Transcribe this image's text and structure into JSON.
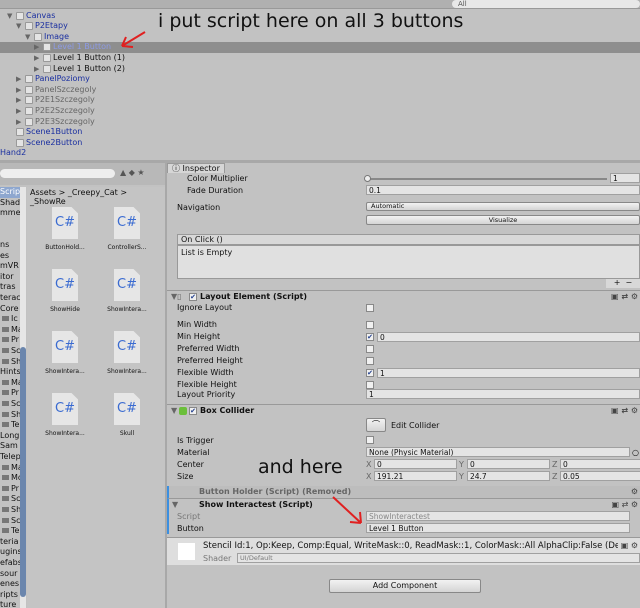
{
  "hierarchy": {
    "search": "All",
    "rows": [
      {
        "label": "Canvas",
        "color": "blue",
        "indent": 0,
        "arrow": "▼"
      },
      {
        "label": "P2Etapy",
        "color": "blue",
        "indent": 1,
        "arrow": "▼"
      },
      {
        "label": "Image",
        "color": "blue",
        "indent": 2,
        "arrow": "▼"
      },
      {
        "label": "Level 1 Button",
        "color": "lblue",
        "indent": 3,
        "arrow": "▶",
        "selected": true
      },
      {
        "label": "Level 1 Button (1)",
        "color": "black",
        "indent": 3,
        "arrow": "▶"
      },
      {
        "label": "Level 1 Button (2)",
        "color": "black",
        "indent": 3,
        "arrow": "▶"
      },
      {
        "label": "PanelPoziomy",
        "color": "blue",
        "indent": 1,
        "arrow": "▶"
      },
      {
        "label": "PanelSzczegoly",
        "color": "grey",
        "indent": 1,
        "arrow": "▶"
      },
      {
        "label": "P2E1Szczegoly",
        "color": "grey",
        "indent": 1,
        "arrow": "▶"
      },
      {
        "label": "P2E2Szczegoly",
        "color": "grey",
        "indent": 1,
        "arrow": "▶"
      },
      {
        "label": "P2E3Szczegoly",
        "color": "grey",
        "indent": 1,
        "arrow": "▶"
      },
      {
        "label": "Scene1Button",
        "color": "blue",
        "indent": 0,
        "arrow": ""
      },
      {
        "label": "Scene2Button",
        "color": "blue",
        "indent": 0,
        "arrow": ""
      },
      {
        "label": "Hand2",
        "color": "blue",
        "indent": -1,
        "arrow": ""
      }
    ]
  },
  "annotations": {
    "top": "i put script here on all 3 buttons",
    "bottom": "and here",
    "arrow_color": "#e02020"
  },
  "project": {
    "breadcrumb": "Assets  >  _Creepy_Cat  >  _ShowRe",
    "folders": [
      {
        "t": "Scrip"
      },
      {
        "t": "Shad"
      },
      {
        "t": "mme"
      },
      {
        "t": ""
      },
      {
        "t": ""
      },
      {
        "t": "ns"
      },
      {
        "t": "es"
      },
      {
        "t": "mVR"
      },
      {
        "t": "itor"
      },
      {
        "t": "tras"
      },
      {
        "t": "terac"
      },
      {
        "t": "Core"
      },
      {
        "t": "Ic",
        "f": 1
      },
      {
        "t": "Ma",
        "f": 1
      },
      {
        "t": "Pr",
        "f": 1
      },
      {
        "t": "Sc",
        "f": 1
      },
      {
        "t": "Sh",
        "f": 1
      },
      {
        "t": "Hints"
      },
      {
        "t": "Ma",
        "f": 1
      },
      {
        "t": "Pr",
        "f": 1
      },
      {
        "t": "Sc",
        "f": 1
      },
      {
        "t": "Sh",
        "f": 1
      },
      {
        "t": "Te",
        "f": 1
      },
      {
        "t": "Long"
      },
      {
        "t": "Sam"
      },
      {
        "t": "Telep"
      },
      {
        "t": "Ma",
        "f": 1
      },
      {
        "t": "Mo",
        "f": 1
      },
      {
        "t": "Pr",
        "f": 1
      },
      {
        "t": "Sc",
        "f": 1
      },
      {
        "t": "Sh",
        "f": 1
      },
      {
        "t": "Sc",
        "f": 1
      },
      {
        "t": "Te",
        "f": 1
      },
      {
        "t": "teria"
      },
      {
        "t": "ugins"
      },
      {
        "t": "efabs"
      },
      {
        "t": "sour"
      },
      {
        "t": "enes"
      },
      {
        "t": "ripts"
      },
      {
        "t": "ture"
      }
    ],
    "files": [
      {
        "icon": "C#",
        "name": "ButtonHold..."
      },
      {
        "icon": "C#",
        "name": "ControllerS..."
      },
      {
        "icon": "C#",
        "name": "ShowHide"
      },
      {
        "icon": "C#",
        "name": "ShowIntera..."
      },
      {
        "icon": "C#",
        "name": "ShowIntera..."
      },
      {
        "icon": "C#",
        "name": "ShowIntera..."
      },
      {
        "icon": "C#",
        "name": "ShowIntera..."
      },
      {
        "icon": "C#",
        "name": "Skull"
      }
    ]
  },
  "inspector": {
    "tab": "Inspector",
    "color_multiplier": {
      "label": "Color Multiplier",
      "value": "1",
      "slider": 0.0
    },
    "fade_duration": {
      "label": "Fade Duration",
      "value": "0.1"
    },
    "navigation": {
      "label": "Navigation",
      "value": "Automatic",
      "visualize": "Visualize"
    },
    "on_click": {
      "title": "On Click ()",
      "empty": "List is Empty",
      "add": "+",
      "remove": "−"
    },
    "layout_element": {
      "title": "Layout Element (Script)",
      "rows": [
        {
          "label": "Ignore Layout",
          "checked": false,
          "value": ""
        },
        {
          "label": "Min Width",
          "checked": false,
          "value": ""
        },
        {
          "label": "Min Height",
          "checked": true,
          "value": "0"
        },
        {
          "label": "Preferred Width",
          "checked": false,
          "value": ""
        },
        {
          "label": "Preferred Height",
          "checked": false,
          "value": ""
        },
        {
          "label": "Flexible Width",
          "checked": true,
          "value": "1"
        },
        {
          "label": "Flexible Height",
          "checked": false,
          "value": ""
        }
      ],
      "priority_label": "Layout Priority",
      "priority": "1"
    },
    "box_collider": {
      "title": "Box Collider",
      "edit": "Edit Collider",
      "is_trigger": "Is Trigger",
      "material_label": "Material",
      "material": "None (Physic Material)",
      "center_label": "Center",
      "center": {
        "x": "0",
        "y": "0",
        "z": "0"
      },
      "size_label": "Size",
      "size": {
        "x": "191.21",
        "y": "24.7",
        "z": "0.05"
      }
    },
    "removed": "Button Holder (Script) (Removed)",
    "show_interactest": {
      "title": "Show Interactest (Script)",
      "script_label": "Script",
      "script": "ShowInteractest",
      "button_label": "Button",
      "button": "Level 1 Button"
    },
    "material": {
      "stencil": "Stencil Id:1, Op:Keep, Comp:Equal, WriteMask::0, ReadMask::1, ColorMask::All AlphaClip:False (Defa",
      "shader_label": "Shader",
      "shader": "UI/Default"
    },
    "add_component": "Add Component"
  }
}
